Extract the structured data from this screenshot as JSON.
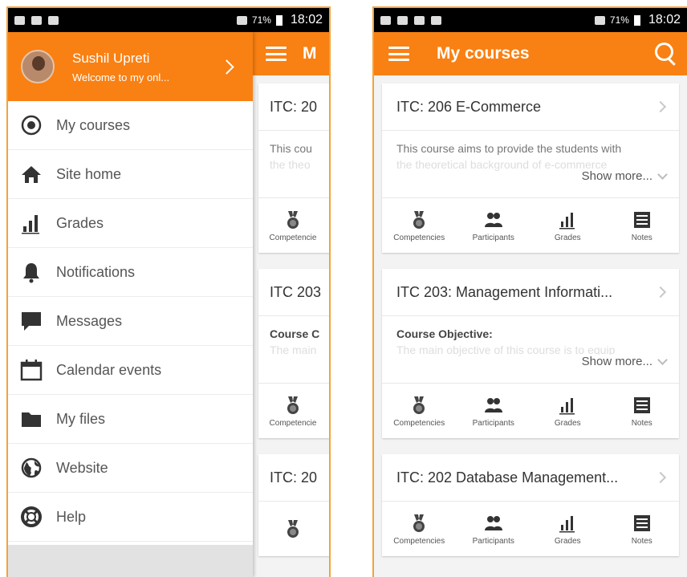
{
  "status_bar": {
    "time": "18:02",
    "battery": "71%"
  },
  "app_bar": {
    "title": "My courses",
    "title_cut": "M"
  },
  "drawer": {
    "user_name": "Sushil Upreti",
    "user_welcome": "Welcome to my onl...",
    "items": [
      {
        "label": "My courses",
        "icon": "radio-target-icon"
      },
      {
        "label": "Site home",
        "icon": "home-icon"
      },
      {
        "label": "Grades",
        "icon": "bar-chart-icon"
      },
      {
        "label": "Notifications",
        "icon": "bell-icon"
      },
      {
        "label": "Messages",
        "icon": "chat-bubble-icon"
      },
      {
        "label": "Calendar events",
        "icon": "calendar-icon"
      },
      {
        "label": "My files",
        "icon": "folder-icon"
      },
      {
        "label": "Website",
        "icon": "globe-icon"
      },
      {
        "label": "Help",
        "icon": "lifebuoy-icon"
      }
    ]
  },
  "behind_cards": [
    {
      "title": "ITC: 20",
      "summary1": "This cou",
      "summary2": "the theo",
      "action": "Competencie"
    },
    {
      "title": "ITC 203",
      "summary1": "Course C",
      "summary2": "The main",
      "action": "Competencie"
    },
    {
      "title": "ITC: 20"
    }
  ],
  "courses": [
    {
      "title": "ITC: 206 E-Commerce",
      "summary1": "This course aims to provide the students with",
      "summary2": "the theoretical background of e-commerce",
      "show_more": "Show more...",
      "actions": [
        "Competencies",
        "Participants",
        "Grades",
        "Notes"
      ]
    },
    {
      "title": "ITC 203: Management Informati...",
      "summary1": "Course Objective:",
      "summary2": "The main objective of this course is to equip",
      "show_more": "Show more...",
      "actions": [
        "Competencies",
        "Participants",
        "Grades",
        "Notes"
      ]
    },
    {
      "title": "ITC: 202 Database Management...",
      "actions": [
        "Competencies",
        "Participants",
        "Grades",
        "Notes"
      ]
    }
  ],
  "colors": {
    "accent": "#f98012",
    "frame": "#f1a43a"
  }
}
